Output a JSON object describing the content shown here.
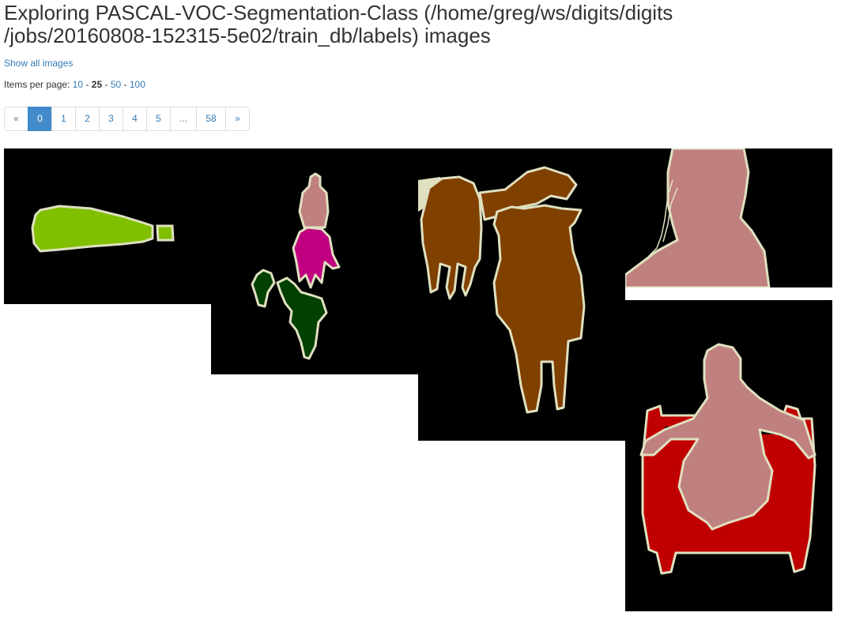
{
  "title": {
    "line1": "Exploring PASCAL-VOC-Segmentation-Class (/home/greg/ws/digits/digits",
    "line2": "/jobs/20160808-152315-5e02/train_db/labels) images"
  },
  "show_all_link": "Show all images",
  "items_per_page": {
    "label": "Items per page:",
    "options": [
      "10",
      "25",
      "50",
      "100"
    ],
    "selected": "25",
    "separator": "-"
  },
  "pagination": {
    "prev": "«",
    "pages": [
      "0",
      "1",
      "2",
      "3",
      "4",
      "5",
      "...",
      "58"
    ],
    "active": "0",
    "next": "»"
  },
  "images": [
    {
      "name": "label-image-1",
      "colors": [
        "#000000",
        "#80c000",
        "#e0e0c0"
      ]
    },
    {
      "name": "label-image-2",
      "colors": [
        "#000000",
        "#c08080",
        "#c00080",
        "#004000",
        "#e0e0c0"
      ]
    },
    {
      "name": "label-image-3",
      "colors": [
        "#000000",
        "#804000",
        "#e0e0c0"
      ]
    },
    {
      "name": "label-image-4",
      "colors": [
        "#000000",
        "#c08080",
        "#e0e0c0"
      ]
    },
    {
      "name": "label-image-5",
      "colors": [
        "#000000",
        "#c00000",
        "#c08080",
        "#e0e0c0"
      ]
    }
  ]
}
